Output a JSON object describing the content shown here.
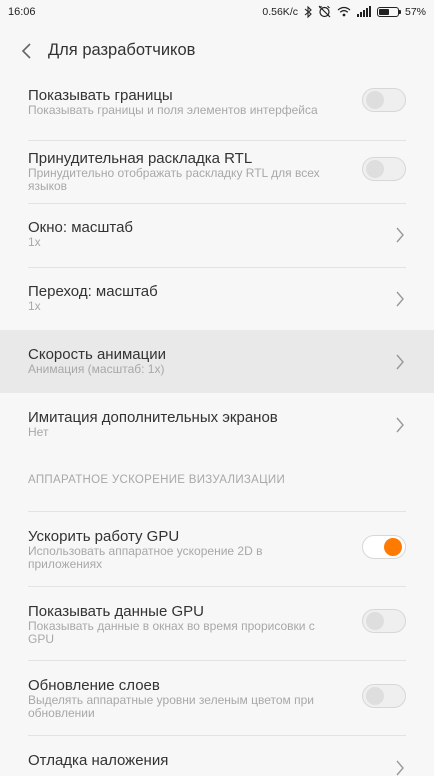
{
  "status_bar": {
    "time": "16:06",
    "net_speed": "0.56K/c",
    "battery_percent": "57%",
    "battery_level": 0.57
  },
  "header": {
    "title": "Для разработчиков"
  },
  "items": [
    {
      "title": "Показывать границы",
      "subtitle": "Показывать границы и поля элементов интерфейса",
      "control": "toggle",
      "on": false
    },
    {
      "title": "Принудительная раскладка RTL",
      "subtitle": "Принудительно отображать раскладку RTL для всех языков",
      "control": "toggle",
      "on": false
    },
    {
      "title": "Окно: масштаб",
      "subtitle": "1x",
      "control": "chevron"
    },
    {
      "title": "Переход: масштаб",
      "subtitle": "1x",
      "control": "chevron"
    },
    {
      "title": "Скорость анимации",
      "subtitle": "Анимация (масштаб: 1x)",
      "control": "chevron",
      "pressed": true
    },
    {
      "title": "Имитация дополнительных экранов",
      "subtitle": "Нет",
      "control": "chevron"
    }
  ],
  "section": {
    "label": "АППАРАТНОЕ УСКОРЕНИЕ ВИЗУАЛИЗАЦИИ"
  },
  "hw_items": [
    {
      "title": "Ускорить работу GPU",
      "subtitle": "Использовать аппаратное ускорение 2D в приложениях",
      "control": "toggle",
      "on": true
    },
    {
      "title": "Показывать данные GPU",
      "subtitle": "Показывать данные в окнах во время прорисовки с GPU",
      "control": "toggle",
      "on": false
    },
    {
      "title": "Обновление слоев",
      "subtitle": "Выделять аппаратные уровни зеленым цветом при обновлении",
      "control": "toggle",
      "on": false
    },
    {
      "title": "Отладка наложения",
      "control": "chevron"
    }
  ],
  "colors": {
    "accent": "#ff7a00",
    "background": "#f7f7f7",
    "pressed_row": "#e9e9e9"
  }
}
